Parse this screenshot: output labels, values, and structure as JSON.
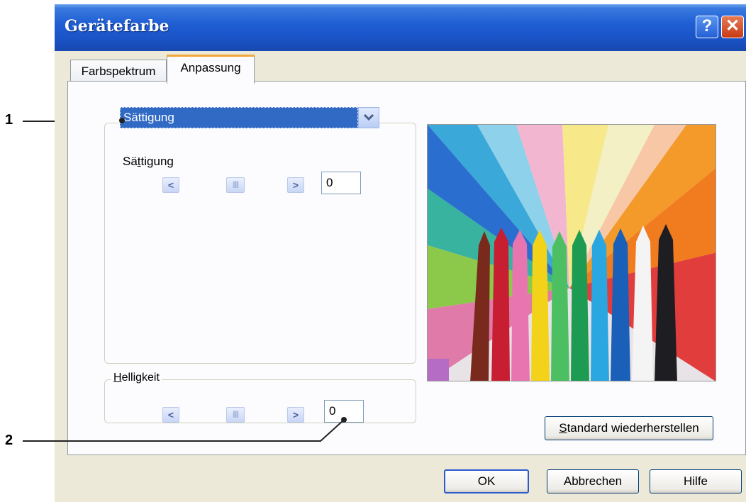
{
  "callouts": [
    "1",
    "2"
  ],
  "dialog": {
    "title": "Gerätefarbe",
    "help_glyph": "?",
    "close_glyph": "✕"
  },
  "tabs": [
    {
      "label": "Farbspektrum",
      "active": false
    },
    {
      "label": "Anpassung",
      "active": true
    }
  ],
  "adjust": {
    "mode_select": "Sättigung",
    "saturation": {
      "prefix": "Sä",
      "mnemonic": "t",
      "rest": "tigung",
      "value": "0"
    },
    "brightness": {
      "mnemonic": "H",
      "rest": "elligkeit",
      "value": "0"
    }
  },
  "buttons": {
    "reset": {
      "mnemonic": "S",
      "rest": "tandard wiederherstellen"
    },
    "ok": "OK",
    "cancel": "Abbrechen",
    "help": "Hilfe"
  },
  "icons": [
    "help-icon",
    "close-icon",
    "chevron-down-icon",
    "arrow-left-icon",
    "arrow-right-icon",
    "slider-thumb-icon"
  ],
  "colors": {
    "titlebar": "#1f5fd4",
    "selection": "#316ac5",
    "dialog_bg": "#ece9d8",
    "tab_highlight": "#f5a83a"
  }
}
